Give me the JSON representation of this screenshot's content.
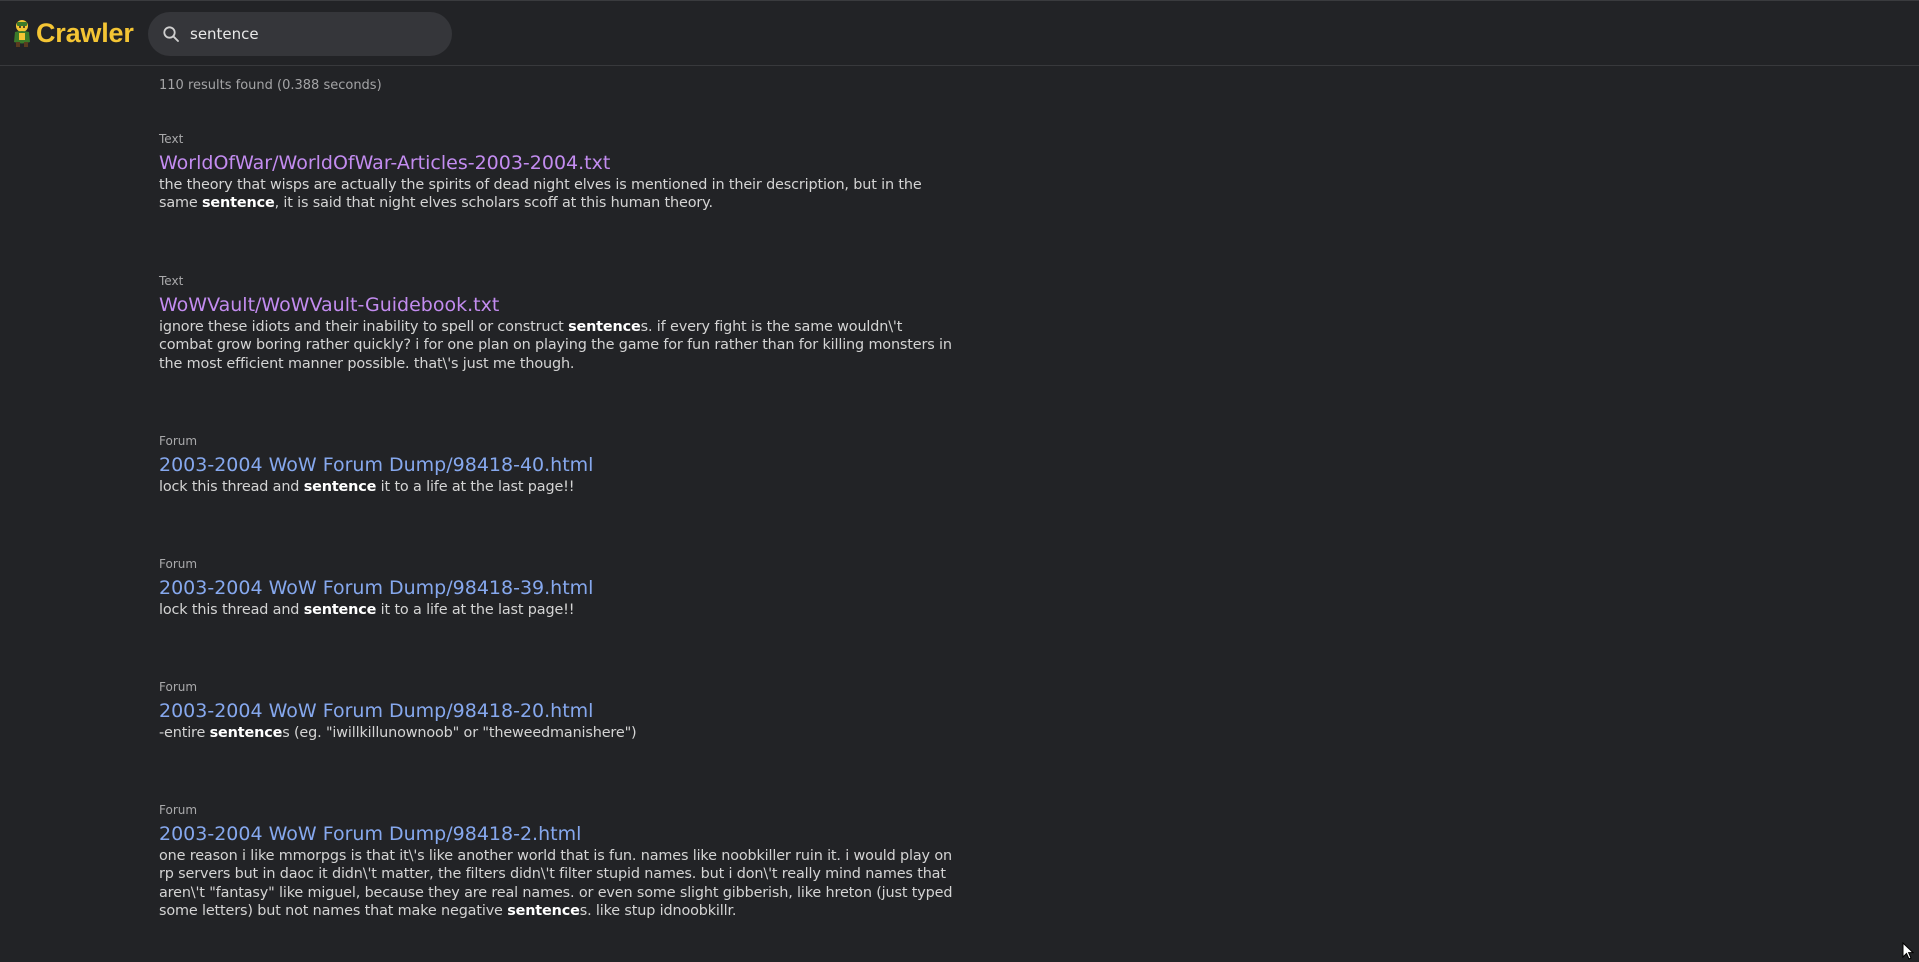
{
  "app": {
    "name": "Crawler",
    "accent_color": "#f4c534"
  },
  "search": {
    "value": "sentence",
    "placeholder": ""
  },
  "stats": {
    "text": "110 results found (0.388 seconds)"
  },
  "highlight_term": "sentence",
  "results": [
    {
      "type": "Text",
      "title": "WorldOfWar/WorldOfWar-Articles-2003-2004.txt",
      "snippet_parts": [
        {
          "t": "the theory that wisps are actually the spirits of dead night elves is mentioned in their description, but in the same "
        },
        {
          "t": "sentence",
          "hl": true
        },
        {
          "t": ", it is said that night elves scholars scoff at this human theory."
        }
      ]
    },
    {
      "type": "Text",
      "title": "WoWVault/WoWVault-Guidebook.txt",
      "snippet_parts": [
        {
          "t": "ignore these idiots and their inability to spell or construct "
        },
        {
          "t": "sentence",
          "hl": true
        },
        {
          "t": "s. if every fight is the same wouldn\\'t combat grow boring rather quickly? i for one plan on playing the game for fun rather than for killing monsters in the most efficient manner possible. that\\'s just me though."
        }
      ]
    },
    {
      "type": "Forum",
      "title": "2003-2004 WoW Forum Dump/98418-40.html",
      "snippet_parts": [
        {
          "t": "lock this thread and "
        },
        {
          "t": "sentence",
          "hl": true
        },
        {
          "t": " it to a life at the last page!!"
        }
      ]
    },
    {
      "type": "Forum",
      "title": "2003-2004 WoW Forum Dump/98418-39.html",
      "snippet_parts": [
        {
          "t": "lock this thread and "
        },
        {
          "t": "sentence",
          "hl": true
        },
        {
          "t": " it to a life at the last page!!"
        }
      ]
    },
    {
      "type": "Forum",
      "title": "2003-2004 WoW Forum Dump/98418-20.html",
      "snippet_parts": [
        {
          "t": "-entire "
        },
        {
          "t": "sentence",
          "hl": true
        },
        {
          "t": "s (eg. \"iwillkillunownoob\" or \"theweedmanishere\")"
        }
      ]
    },
    {
      "type": "Forum",
      "title": "2003-2004 WoW Forum Dump/98418-2.html",
      "snippet_parts": [
        {
          "t": "one reason i like mmorpgs is that it\\'s like another world that is fun. names like noobkiller ruin it. i would play on rp servers but in daoc it didn\\'t matter, the filters didn\\'t filter stupid names. but i don\\'t really mind names that aren\\'t \"fantasy\" like miguel, because they are real names. or even some slight gibberish, like hreton (just typed some letters) but not names that make negative "
        },
        {
          "t": "sentence",
          "hl": true
        },
        {
          "t": "s. like stup idnoobkillr."
        }
      ]
    }
  ],
  "colors": {
    "background": "#222326",
    "text_title": "#c38cf0",
    "forum_title": "#86a8ee"
  },
  "icons": {
    "logo": "crawler-mascot-icon",
    "search": "search-icon",
    "cursor": "mouse-cursor-icon"
  }
}
